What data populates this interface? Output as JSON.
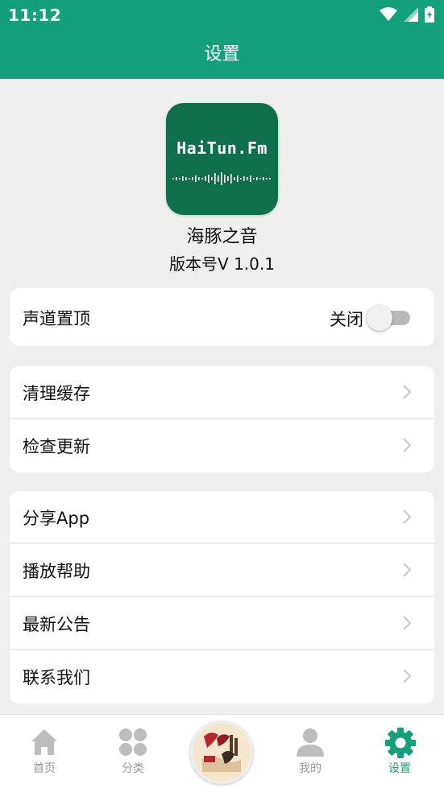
{
  "status_bar": {
    "time": "11:12"
  },
  "header": {
    "title": "设置"
  },
  "app": {
    "logo_text": "HaiTun.Fm",
    "name": "海豚之音",
    "version": "版本号V 1.0.1"
  },
  "settings": {
    "channel_top": {
      "label": "声道置顶",
      "toggle_label": "关闭",
      "enabled": false
    },
    "group1": [
      {
        "label": "清理缓存"
      },
      {
        "label": "检查更新"
      }
    ],
    "group2": [
      {
        "label": "分享App"
      },
      {
        "label": "播放帮助"
      },
      {
        "label": "最新公告"
      },
      {
        "label": "联系我们"
      }
    ]
  },
  "bottom_nav": {
    "items": [
      {
        "label": "首页",
        "icon": "home-icon"
      },
      {
        "label": "分类",
        "icon": "grid-icon"
      },
      {
        "label": "",
        "icon": "now-playing-cover"
      },
      {
        "label": "我的",
        "icon": "person-icon"
      },
      {
        "label": "设置",
        "icon": "gear-icon",
        "active": true
      }
    ]
  },
  "colors": {
    "primary": "#14a07a",
    "logo_bg": "#0f6e4b",
    "background": "#efefef",
    "inactive": "#999999"
  }
}
